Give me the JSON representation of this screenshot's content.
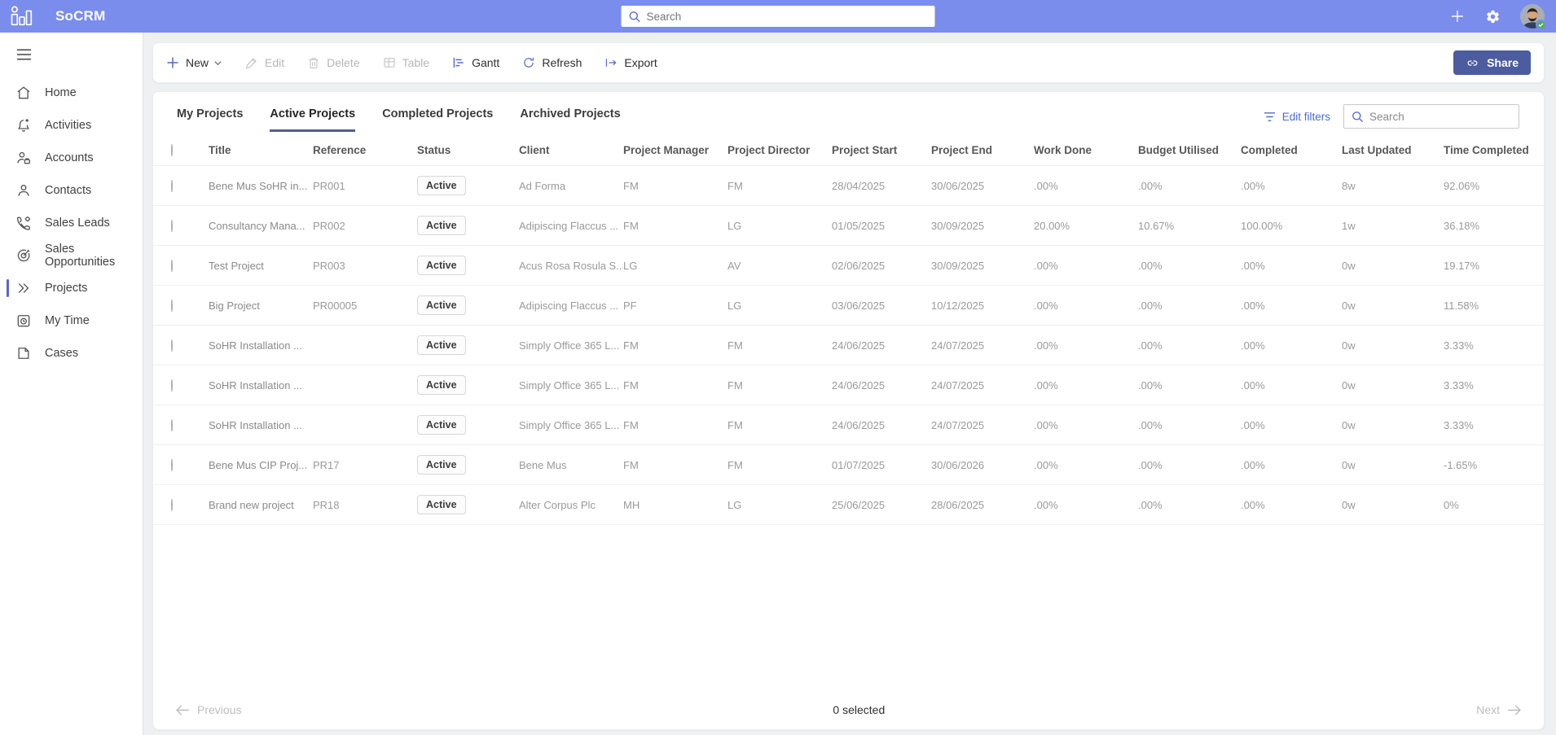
{
  "topbar": {
    "app_name": "SoCRM",
    "search_placeholder": "Search",
    "icons": [
      "add-icon",
      "gear-icon",
      "avatar"
    ]
  },
  "sidebar": {
    "items": [
      {
        "label": "Home",
        "icon": "home-icon",
        "active": false
      },
      {
        "label": "Activities",
        "icon": "bell-icon",
        "active": false
      },
      {
        "label": "Accounts",
        "icon": "person-briefcase-icon",
        "active": false
      },
      {
        "label": "Contacts",
        "icon": "person-icon",
        "active": false
      },
      {
        "label": "Sales Leads",
        "icon": "phone-gear-icon",
        "active": false
      },
      {
        "label": "Sales Opportunities",
        "icon": "target-icon",
        "active": false
      },
      {
        "label": "Projects",
        "icon": "double-chevron-icon",
        "active": true
      },
      {
        "label": "My Time",
        "icon": "clock-box-icon",
        "active": false
      },
      {
        "label": "Cases",
        "icon": "document-icon",
        "active": false
      }
    ]
  },
  "toolbar": {
    "buttons": [
      {
        "label": "New",
        "icon": "plus-icon",
        "has_dropdown": true,
        "enabled": true
      },
      {
        "label": "Edit",
        "icon": "pencil-icon",
        "enabled": false
      },
      {
        "label": "Delete",
        "icon": "trash-icon",
        "enabled": false
      },
      {
        "label": "Table",
        "icon": "table-icon",
        "enabled": false
      },
      {
        "label": "Gantt",
        "icon": "gantt-icon",
        "enabled": true
      },
      {
        "label": "Refresh",
        "icon": "refresh-icon",
        "enabled": true
      },
      {
        "label": "Export",
        "icon": "export-icon",
        "enabled": true
      }
    ],
    "share": {
      "label": "Share",
      "icon": "link-icon"
    }
  },
  "tabs": {
    "items": [
      {
        "label": "My Projects",
        "active": false
      },
      {
        "label": "Active Projects",
        "active": true
      },
      {
        "label": "Completed Projects",
        "active": false
      },
      {
        "label": "Archived Projects",
        "active": false
      }
    ]
  },
  "filters": {
    "edit_filters_label": "Edit filters",
    "search_placeholder": "Search"
  },
  "table": {
    "columns": [
      "Title",
      "Reference",
      "Status",
      "Client",
      "Project Manager",
      "Project Director",
      "Project Start",
      "Project End",
      "Work Done",
      "Budget Utilised",
      "Completed",
      "Last Updated",
      "Time Completed"
    ],
    "rows": [
      {
        "title": "Bene Mus SoHR in...",
        "reference": "PR001",
        "status": "Active",
        "client": "Ad Forma",
        "project_manager": "FM",
        "project_director": "FM",
        "project_start": "28/04/2025",
        "project_end": "30/06/2025",
        "work_done": ".00%",
        "budget_utilised": ".00%",
        "completed": ".00%",
        "last_updated": "8w",
        "time_completed": "92.06%"
      },
      {
        "title": "Consultancy Mana...",
        "reference": "PR002",
        "status": "Active",
        "client": "Adipiscing Flaccus ...",
        "project_manager": "FM",
        "project_director": "LG",
        "project_start": "01/05/2025",
        "project_end": "30/09/2025",
        "work_done": "20.00%",
        "budget_utilised": "10.67%",
        "completed": "100.00%",
        "last_updated": "1w",
        "time_completed": "36.18%"
      },
      {
        "title": "Test Project",
        "reference": "PR003",
        "status": "Active",
        "client": "Acus Rosa Rosula S...",
        "project_manager": "LG",
        "project_director": "AV",
        "project_start": "02/06/2025",
        "project_end": "30/09/2025",
        "work_done": ".00%",
        "budget_utilised": ".00%",
        "completed": ".00%",
        "last_updated": "0w",
        "time_completed": "19.17%"
      },
      {
        "title": "Big Project",
        "reference": "PR00005",
        "status": "Active",
        "client": "Adipiscing Flaccus ...",
        "project_manager": "PF",
        "project_director": "LG",
        "project_start": "03/06/2025",
        "project_end": "10/12/2025",
        "work_done": ".00%",
        "budget_utilised": ".00%",
        "completed": ".00%",
        "last_updated": "0w",
        "time_completed": "11.58%"
      },
      {
        "title": "SoHR Installation ...",
        "reference": "",
        "status": "Active",
        "client": "Simply Office 365 L...",
        "project_manager": "FM",
        "project_director": "FM",
        "project_start": "24/06/2025",
        "project_end": "24/07/2025",
        "work_done": ".00%",
        "budget_utilised": ".00%",
        "completed": ".00%",
        "last_updated": "0w",
        "time_completed": "3.33%"
      },
      {
        "title": "SoHR Installation ...",
        "reference": "",
        "status": "Active",
        "client": "Simply Office 365 L...",
        "project_manager": "FM",
        "project_director": "FM",
        "project_start": "24/06/2025",
        "project_end": "24/07/2025",
        "work_done": ".00%",
        "budget_utilised": ".00%",
        "completed": ".00%",
        "last_updated": "0w",
        "time_completed": "3.33%"
      },
      {
        "title": "SoHR Installation ...",
        "reference": "",
        "status": "Active",
        "client": "Simply Office 365 L...",
        "project_manager": "FM",
        "project_director": "FM",
        "project_start": "24/06/2025",
        "project_end": "24/07/2025",
        "work_done": ".00%",
        "budget_utilised": ".00%",
        "completed": ".00%",
        "last_updated": "0w",
        "time_completed": "3.33%"
      },
      {
        "title": "Bene Mus CIP Proj...",
        "reference": "PR17",
        "status": "Active",
        "client": "Bene Mus",
        "project_manager": "FM",
        "project_director": "FM",
        "project_start": "01/07/2025",
        "project_end": "30/06/2026",
        "work_done": ".00%",
        "budget_utilised": ".00%",
        "completed": ".00%",
        "last_updated": "0w",
        "time_completed": "-1.65%"
      },
      {
        "title": "Brand new project",
        "reference": "PR18",
        "status": "Active",
        "client": "Alter Corpus Plc",
        "project_manager": "MH",
        "project_director": "LG",
        "project_start": "25/06/2025",
        "project_end": "28/06/2025",
        "work_done": ".00%",
        "budget_utilised": ".00%",
        "completed": ".00%",
        "last_updated": "0w",
        "time_completed": "0%"
      }
    ]
  },
  "footer": {
    "previous_label": "Previous",
    "selected_text": "0 selected",
    "next_label": "Next"
  },
  "colors": {
    "topbar_bg": "#7a8cec",
    "accent": "#5866c9",
    "share_bg": "#4d5c9e",
    "tab_underline": "#515e91",
    "link": "#4b6bd6",
    "status_green": "#4cb04f"
  }
}
